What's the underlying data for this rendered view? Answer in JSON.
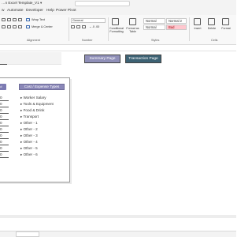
{
  "window": {
    "title": "…n Excel Template_V1 ▾"
  },
  "menu": {
    "tabs": [
      "w",
      "Automate",
      "Developer",
      "Help",
      "Power Pivot"
    ]
  },
  "ribbon": {
    "alignment": {
      "wrap_text": "Wrap Text",
      "merge_center": "Merge & Center",
      "group_label": "Alignment"
    },
    "number": {
      "format_value": "General",
      "group_label": "Number",
      "decimals": "←.0 .00"
    },
    "styles": {
      "conditional_formatting": "Conditional Formatting",
      "format_as_table": "Format as Table",
      "normal": "Normal",
      "normal_2": "Normal 2",
      "normal_tail": "Normal",
      "bad": "Bad",
      "group_label": "Styles"
    },
    "cells": {
      "insert": "Insert",
      "delete": "Delete",
      "format": "Format",
      "group_label": "Cells"
    }
  },
  "sheet": {
    "buttons": {
      "summary": "Summary Page",
      "transaction": "Transaction Page"
    },
    "card": {
      "left_header": "ad",
      "right_header": "Cost / Expense Types",
      "rows": [
        {
          "num": "0",
          "category": "Worker Salary"
        },
        {
          "num": "0",
          "category": "Tools & Equipment"
        },
        {
          "num": "0",
          "category": "Food & Drink"
        },
        {
          "num": "0",
          "category": "Transport"
        },
        {
          "num": "0",
          "category": "Other - 1"
        },
        {
          "num": "0",
          "category": "Other - 2"
        },
        {
          "num": "0",
          "category": "Other - 3"
        },
        {
          "num": "0",
          "category": "Other - 4"
        },
        {
          "num": "0",
          "category": "Other - 5"
        },
        {
          "num": "0",
          "category": "Other - 6"
        }
      ]
    }
  },
  "colors": {
    "summary_button": "#8f8fb8",
    "transaction_button": "#3d6274",
    "header_pill": "#8a87b8",
    "bad_style": "#ffc7ce"
  }
}
